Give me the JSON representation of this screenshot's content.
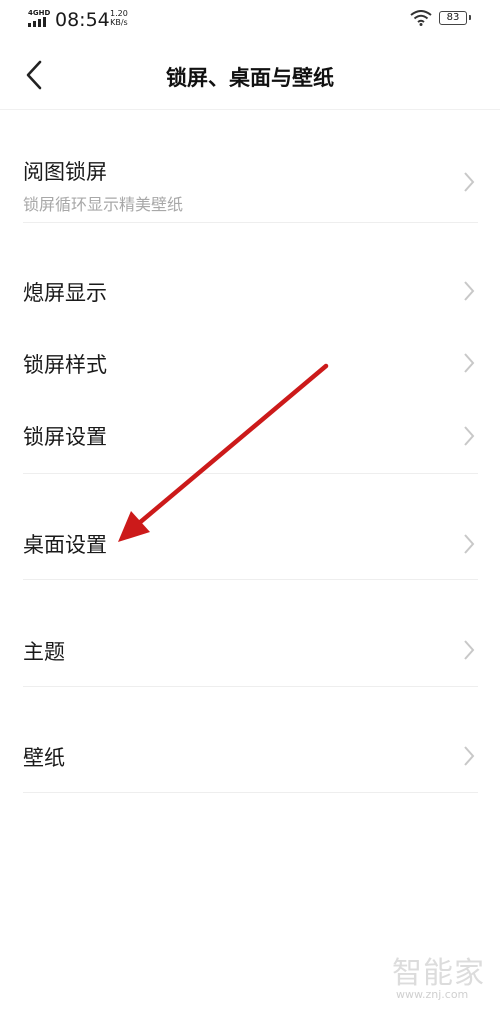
{
  "status_bar": {
    "network": "4GHD",
    "time": "08:54",
    "speed_value": "1.20",
    "speed_unit": "KB/s",
    "battery": "83"
  },
  "header": {
    "title": "锁屏、桌面与壁纸"
  },
  "items": [
    {
      "label": "阅图锁屏",
      "sub": "锁屏循环显示精美壁纸"
    },
    {
      "label": "熄屏显示"
    },
    {
      "label": "锁屏样式"
    },
    {
      "label": "锁屏设置"
    },
    {
      "label": "桌面设置"
    },
    {
      "label": "主题"
    },
    {
      "label": "壁纸"
    }
  ],
  "annotation": {
    "arrow_color": "#cc1a1a",
    "target": "桌面设置"
  },
  "watermark": {
    "logo": "智能家",
    "url": "www.znj.com"
  },
  "colors": {
    "background": "#ffffff",
    "text": "#1a1a1a",
    "subtext": "#a8a8a8",
    "divider": "#eeeeee",
    "chevron": "#c8c8c8"
  }
}
